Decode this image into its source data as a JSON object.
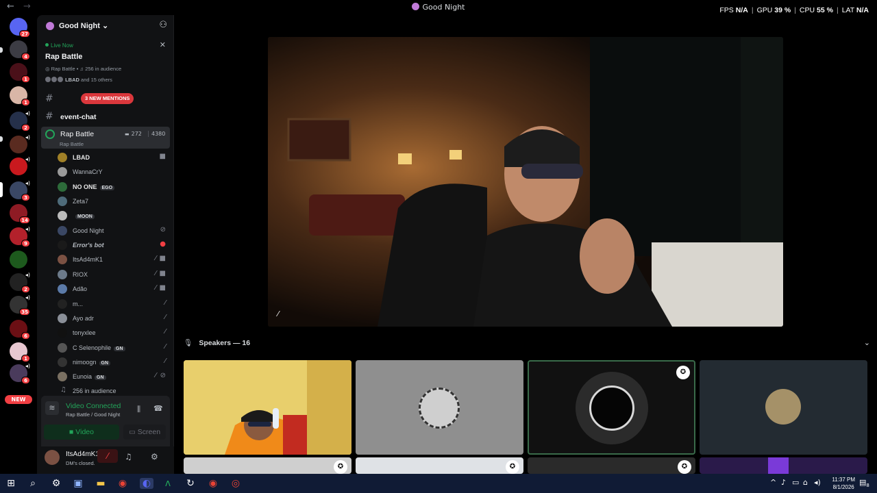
{
  "titlebar": {
    "title": "Good Night",
    "back": "←",
    "forward": "→"
  },
  "overlay": {
    "fps_label": "FPS",
    "fps": "N/A",
    "gpu_label": "GPU",
    "gpu": "39 %",
    "cpu_label": "CPU",
    "cpu": "55 %",
    "lat_label": "LAT",
    "lat": "N/A"
  },
  "rail": {
    "badges": [
      "27",
      "4",
      "1",
      "1",
      "2",
      "3",
      "14",
      "9",
      "2",
      "35",
      "6",
      "1",
      "6"
    ],
    "new_label": "NEW"
  },
  "guild": {
    "name": "Good Night"
  },
  "live": {
    "status": "Live Now",
    "title": "Rap Battle",
    "meta_channel": "Rap Battle",
    "meta_audience": "256 in audience",
    "attendees_name": "LBAD",
    "attendees_rest": "and 15 others"
  },
  "channels": {
    "mentions_label": "3 NEW MENTIONS",
    "event_chat": "event-chat",
    "voice_name": "Rap Battle",
    "voice_sub": "Rap Battle",
    "voice_video_count": "272",
    "voice_user_count": "4380"
  },
  "members": [
    {
      "name": "LBAD",
      "tag": ""
    },
    {
      "name": "WannaCrY",
      "tag": ""
    },
    {
      "name": "NO ONE",
      "tag": "EGO"
    },
    {
      "name": "Zeta7",
      "tag": ""
    },
    {
      "name": "",
      "tag": "MOON"
    },
    {
      "name": "Good Night",
      "tag": ""
    },
    {
      "name": "Error's bot",
      "tag": ""
    },
    {
      "name": "ItsAd4mK1",
      "tag": ""
    },
    {
      "name": "RIOX",
      "tag": ""
    },
    {
      "name": "Adão",
      "tag": ""
    },
    {
      "name": "m...",
      "tag": ""
    },
    {
      "name": "Ayo adr",
      "tag": ""
    },
    {
      "name": "tonyxlee",
      "tag": ""
    },
    {
      "name": "C Selenophile",
      "tag": "GN"
    },
    {
      "name": "nimoogn",
      "tag": "GN"
    },
    {
      "name": "Eunoia",
      "tag": "GN"
    }
  ],
  "audience": "256 in audience",
  "rtc": {
    "status": "Video Connected",
    "location": "Rap Battle / Good Night",
    "video_label": "Video",
    "screen_label": "Screen"
  },
  "user": {
    "name": "ItsAd4mK1",
    "status": "DM's closed."
  },
  "stage": {
    "speakers_label": "Speakers — 16"
  },
  "taskbar": {
    "time": "11:37 PM",
    "date": "8/1/2026",
    "notif_count": "8"
  }
}
